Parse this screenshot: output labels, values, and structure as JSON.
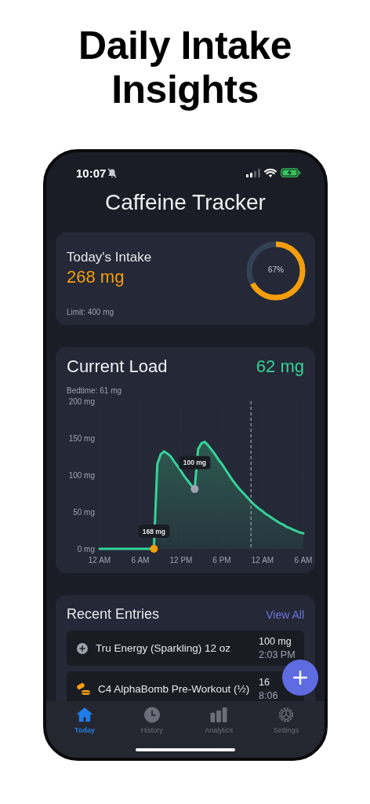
{
  "headline": "Daily Intake Insights",
  "status_bar": {
    "time": "10:07"
  },
  "title": "Caffeine Tracker",
  "intake": {
    "label": "Today's Intake",
    "amount": "268 mg",
    "limit": "Limit: 400 mg",
    "percent": "67%",
    "level": 0.67
  },
  "load": {
    "label": "Current Load",
    "amount": "62 mg",
    "bedtime": "Bedtime: 61 mg",
    "markers": [
      {
        "label": "168 mg",
        "color": "#f59e0b"
      },
      {
        "label": "100 mg",
        "color": "#9ca3af"
      }
    ],
    "chart_data": {
      "type": "area",
      "ylim": [
        0,
        200
      ],
      "categories": [
        "12 AM",
        null,
        null,
        null,
        null,
        null,
        null,
        null,
        null,
        null,
        null,
        null,
        "6 AM",
        null,
        null,
        null,
        null,
        null,
        null,
        null,
        null,
        null,
        null,
        null,
        "12 PM",
        null,
        null,
        null,
        null,
        null,
        null,
        null,
        null,
        null,
        null,
        null,
        "6 PM",
        null,
        null,
        null,
        null,
        null,
        null,
        null,
        null,
        null,
        null,
        null,
        "12 AM",
        null,
        null,
        null,
        null,
        null,
        null,
        null,
        null,
        null,
        null,
        null,
        "6 AM"
      ],
      "yticks": [
        {
          "value": 0,
          "label": "0 mg"
        },
        {
          "value": 50,
          "label": "50 mg"
        },
        {
          "value": 100,
          "label": "100 mg"
        },
        {
          "value": 150,
          "label": "150 mg"
        },
        {
          "value": 200,
          "label": "200 mg"
        }
      ],
      "series": [
        {
          "color": "#34d399",
          "values": [
            0,
            0,
            0,
            0,
            0,
            0,
            0,
            0,
            0,
            0,
            0,
            0,
            0,
            0,
            0,
            0,
            0,
            115,
            128,
            132,
            129,
            125,
            118,
            112,
            105,
            98,
            92,
            86,
            81,
            135,
            143,
            145,
            140,
            134,
            128,
            121,
            115,
            108,
            101,
            94,
            88,
            82,
            77,
            72,
            67,
            62,
            58,
            54,
            51,
            47,
            44,
            41,
            38,
            35,
            33,
            30,
            28,
            26,
            24,
            22,
            21
          ]
        }
      ]
    }
  },
  "recent": {
    "title": "Recent Entries",
    "link": "View All",
    "entries": [
      {
        "kind": "plus",
        "name": "Tru Energy (Sparkling) 12 oz",
        "amount": "100 mg",
        "time": "2:03 PM"
      },
      {
        "kind": "pills",
        "name": "C4 AlphaBomb Pre-Workout (½)",
        "amount": "16",
        "time": "8:06"
      }
    ]
  },
  "tabs": [
    {
      "kind": "home",
      "label": "Today",
      "selected": true
    },
    {
      "kind": "clock",
      "label": "History",
      "selected": false
    },
    {
      "kind": "bars",
      "label": "Analytics",
      "selected": false
    },
    {
      "kind": "gear",
      "label": "Settings",
      "selected": false
    }
  ]
}
